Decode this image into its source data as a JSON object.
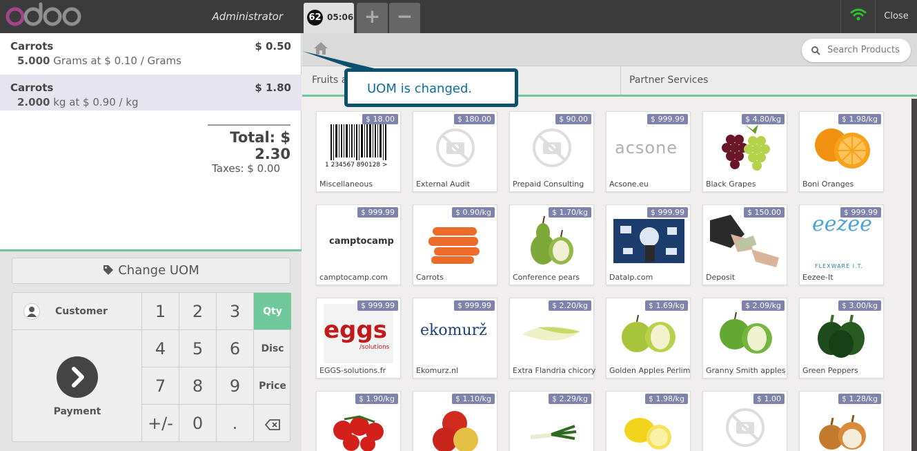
{
  "topbar": {
    "logo": "odoo",
    "user": "Administrator",
    "order_number": "62",
    "order_time": "05:06",
    "add_label": "+",
    "remove_label": "−",
    "close_label": "Close"
  },
  "order": {
    "lines": [
      {
        "name": "Carrots",
        "price": "$ 0.50",
        "qty": "5.000",
        "unit_text": "Grams at $ 0.10 / Grams"
      },
      {
        "name": "Carrots",
        "price": "$ 1.80",
        "qty": "2.000",
        "unit_text": "kg at $ 0.90 / kg"
      }
    ],
    "total": "Total: $ 2.30",
    "taxes": "Taxes: $ 0.00"
  },
  "controls": {
    "change_uom": "Change UOM",
    "customer": "Customer",
    "payment": "Payment",
    "keys": [
      "1",
      "2",
      "3",
      "4",
      "5",
      "6",
      "7",
      "8",
      "9",
      "+/-",
      "0",
      "."
    ],
    "modes": [
      "Qty",
      "Disc",
      "Price"
    ],
    "active_mode": "Qty"
  },
  "products_panel": {
    "search_placeholder": "Search Products",
    "categories": [
      "Fruits a",
      "Partner Services"
    ]
  },
  "callout": "UOM is changed.",
  "products": [
    {
      "name": "Miscellaneous",
      "price": "$ 18.00"
    },
    {
      "name": "External Audit",
      "price": "$ 180.00"
    },
    {
      "name": "Prepaid Consulting",
      "price": "$ 90.00"
    },
    {
      "name": "Acsone.eu",
      "price": "$ 999.99"
    },
    {
      "name": "Black Grapes",
      "price": "$ 4.80/kg"
    },
    {
      "name": "Boni Oranges",
      "price": "$ 1.98/kg"
    },
    {
      "name": "camptocamp.com",
      "price": "$ 999.99"
    },
    {
      "name": "Carrots",
      "price": "$ 0.90/kg"
    },
    {
      "name": "Conference pears",
      "price": "$ 1.70/kg"
    },
    {
      "name": "Datalp.com",
      "price": "$ 999.99"
    },
    {
      "name": "Deposit",
      "price": "$ 150.00"
    },
    {
      "name": "Eezee-It",
      "price": "$ 999.99"
    },
    {
      "name": "EGGS-solutions.fr",
      "price": "$ 999.99"
    },
    {
      "name": "Ekomurz.nl",
      "price": "$ 999.99"
    },
    {
      "name": "Extra Flandria chicory",
      "price": "$ 2.20/kg"
    },
    {
      "name": "Golden Apples Perlim",
      "price": "$ 1.69/kg"
    },
    {
      "name": "Granny Smith apples",
      "price": "$ 2.09/kg"
    },
    {
      "name": "Green Peppers",
      "price": "$ 3.00/kg"
    },
    {
      "name": "",
      "price": "$ 1.90/kg"
    },
    {
      "name": "",
      "price": "$ 1.10/kg"
    },
    {
      "name": "",
      "price": "$ 2.29/kg"
    },
    {
      "name": "",
      "price": "$ 1.98/kg"
    },
    {
      "name": "",
      "price": "$ 1.00"
    },
    {
      "name": "",
      "price": "$ 1.28/kg"
    }
  ],
  "product_logo_texts": {
    "barcode": "1 234567 890128 >",
    "acsone": "acsone",
    "camptocamp": "camptocamp",
    "eezee": "eezee",
    "eezee_sub": "FLEXWARE I.T.",
    "eggs": "eggs",
    "eggs_sub": "/solutions",
    "ekomurz": "ekomurž"
  },
  "colors": {
    "accent": "#6ec89b",
    "price_tag": "#7f82ac",
    "topbar": "#3b3b3b",
    "callout_border": "#0c506e",
    "wifi": "#2fc42f"
  }
}
